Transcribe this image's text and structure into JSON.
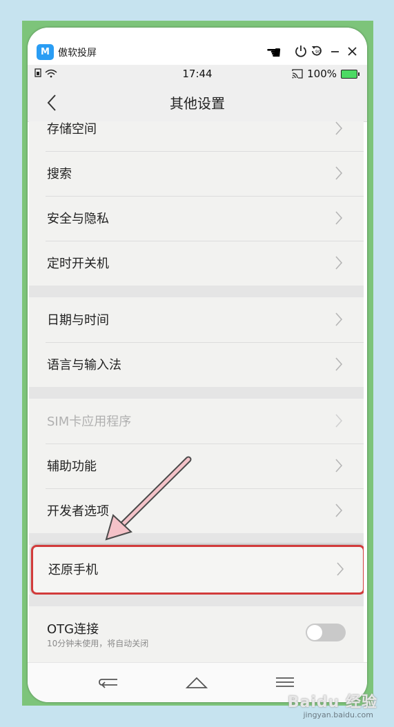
{
  "app": {
    "logo_text": "M",
    "title": "傲软投屏"
  },
  "status_bar": {
    "time": "17:44",
    "battery": "100%"
  },
  "nav": {
    "title": "其他设置"
  },
  "groups": [
    {
      "items": [
        {
          "label": "存储空间"
        },
        {
          "label": "搜索"
        },
        {
          "label": "安全与隐私"
        },
        {
          "label": "定时开关机"
        }
      ]
    },
    {
      "items": [
        {
          "label": "日期与时间"
        },
        {
          "label": "语言与输入法"
        }
      ]
    },
    {
      "items": [
        {
          "label": "SIM卡应用程序",
          "disabled": true
        },
        {
          "label": "辅助功能"
        },
        {
          "label": "开发者选项"
        }
      ]
    }
  ],
  "highlighted_item": {
    "label": "还原手机"
  },
  "otg": {
    "label": "OTG连接",
    "subtitle": "10分钟未使用，将自动关闭",
    "enabled": false
  },
  "colors": {
    "highlight_border": "#d23b3b",
    "frame_green": "#7dc47a",
    "background": "#c6e3ef"
  },
  "watermark": {
    "text": "Baidu 经验",
    "url": "jingyan.baidu.com"
  }
}
